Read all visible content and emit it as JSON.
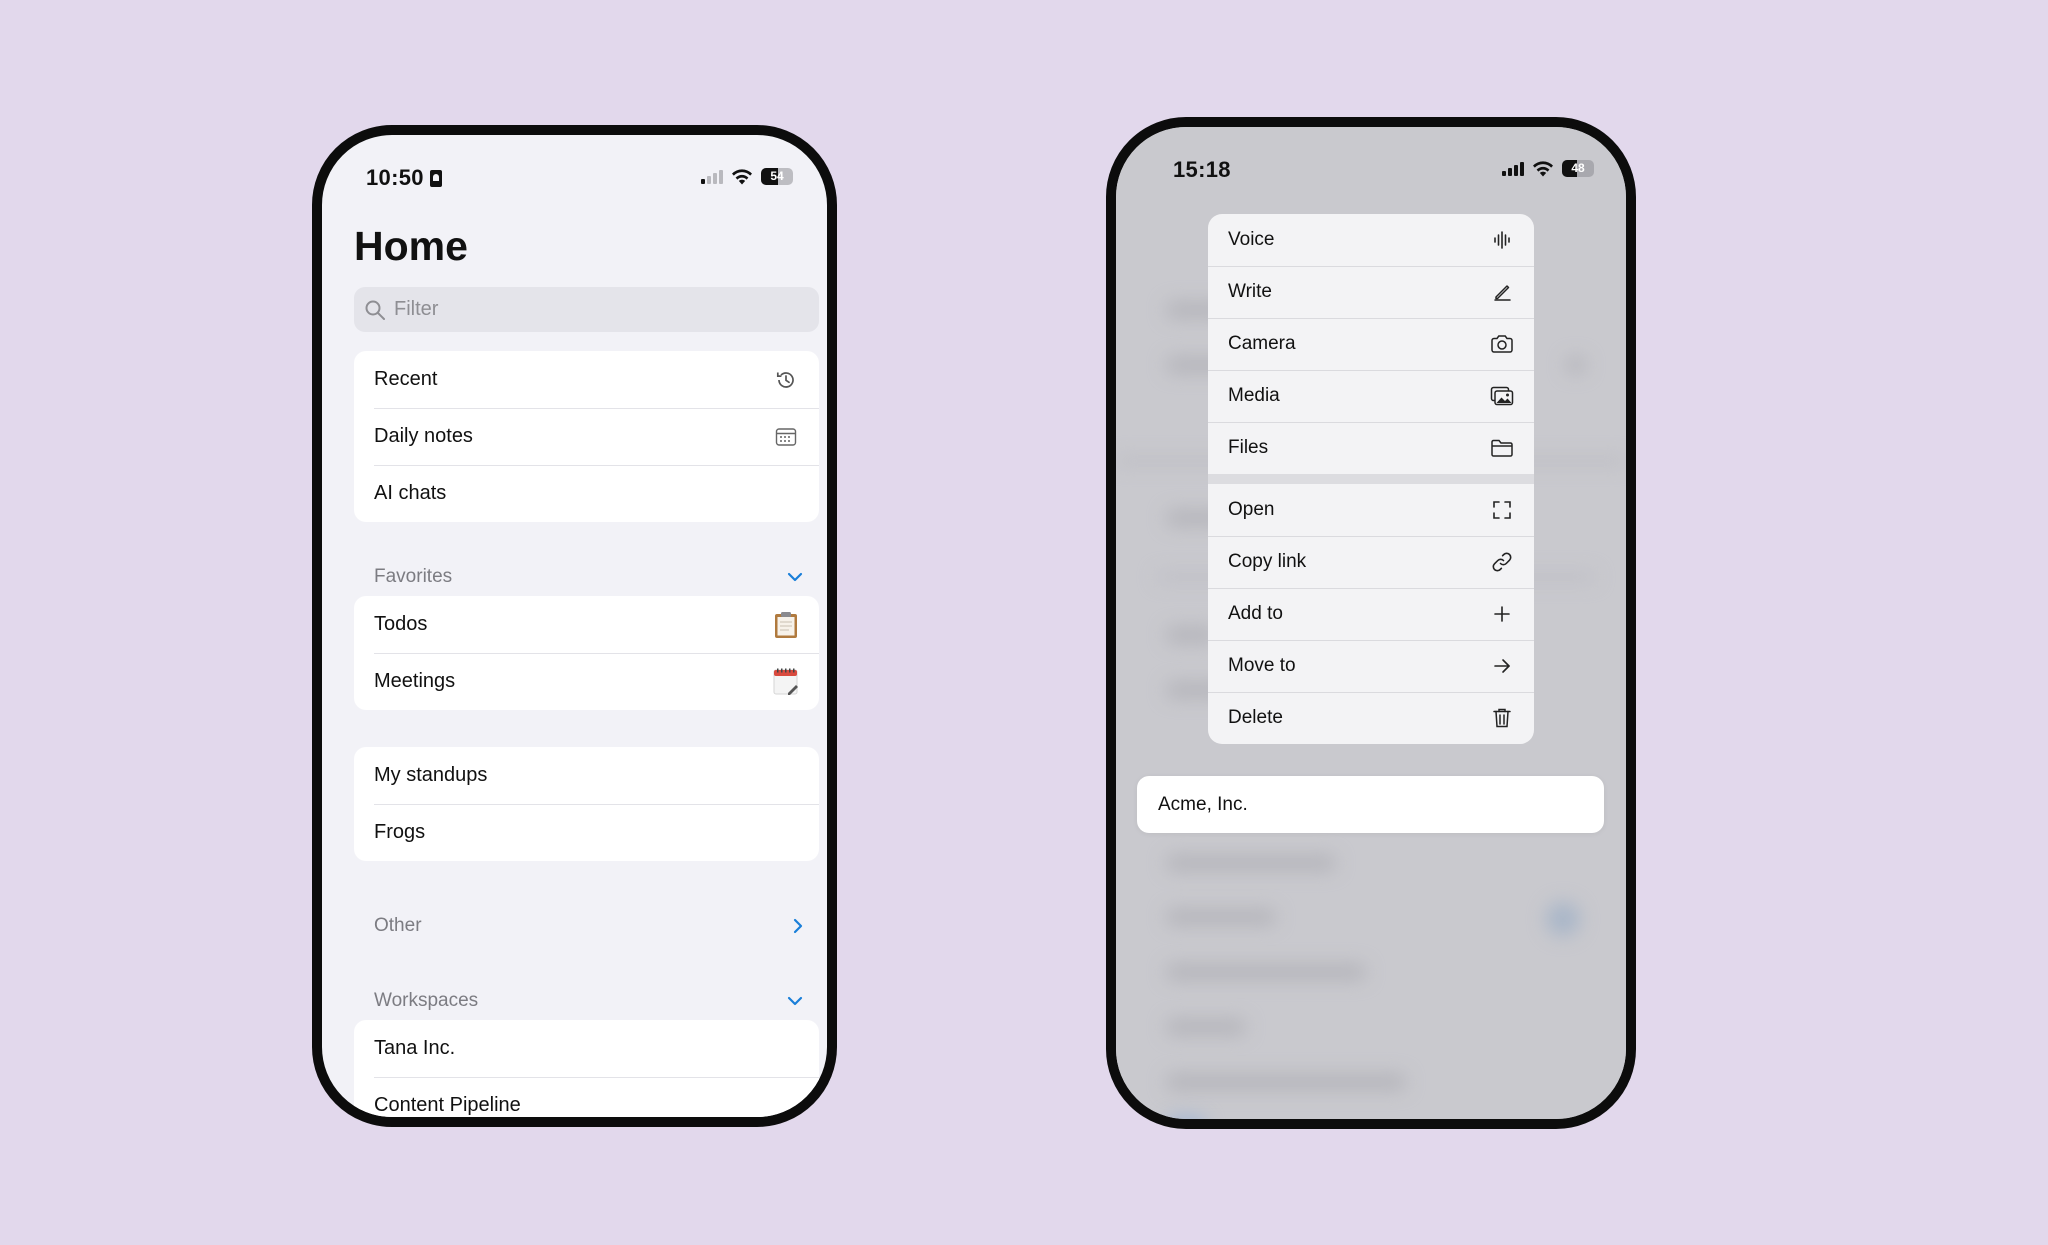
{
  "left_phone": {
    "status_time": "10:50",
    "battery_level": "54",
    "title": "Home",
    "filter_placeholder": "Filter",
    "main_items": [
      {
        "label": "Recent",
        "icon": "history-icon"
      },
      {
        "label": "Daily notes",
        "icon": "calendar-icon"
      },
      {
        "label": "AI chats",
        "icon": ""
      }
    ],
    "favorites": {
      "label": "Favorites",
      "items": [
        {
          "label": "Todos",
          "icon": "clipboard-icon"
        },
        {
          "label": "Meetings",
          "icon": "calendar-page-icon"
        }
      ]
    },
    "pinned_items": [
      {
        "label": "My standups"
      },
      {
        "label": "Frogs"
      }
    ],
    "other": {
      "label": "Other"
    },
    "workspaces": {
      "label": "Workspaces",
      "items": [
        {
          "label": "Tana Inc."
        },
        {
          "label": "Content Pipeline"
        }
      ]
    }
  },
  "right_phone": {
    "status_time": "15:18",
    "battery_level": "48",
    "menu_group_1": [
      {
        "label": "Voice",
        "icon": "waveform-icon"
      },
      {
        "label": "Write",
        "icon": "pencil-icon"
      },
      {
        "label": "Camera",
        "icon": "camera-icon"
      },
      {
        "label": "Media",
        "icon": "photos-icon"
      },
      {
        "label": "Files",
        "icon": "folder-icon"
      }
    ],
    "menu_group_2": [
      {
        "label": "Open",
        "icon": "expand-icon"
      },
      {
        "label": "Copy link",
        "icon": "link-icon"
      },
      {
        "label": "Add to",
        "icon": "plus-icon"
      },
      {
        "label": "Move to",
        "icon": "arrow-right-icon"
      },
      {
        "label": "Delete",
        "icon": "trash-icon"
      }
    ],
    "selected_card": "Acme, Inc."
  },
  "colors": {
    "background": "#e2d8ec",
    "accent": "#1a7fd9",
    "section_label": "#7c7c82"
  }
}
